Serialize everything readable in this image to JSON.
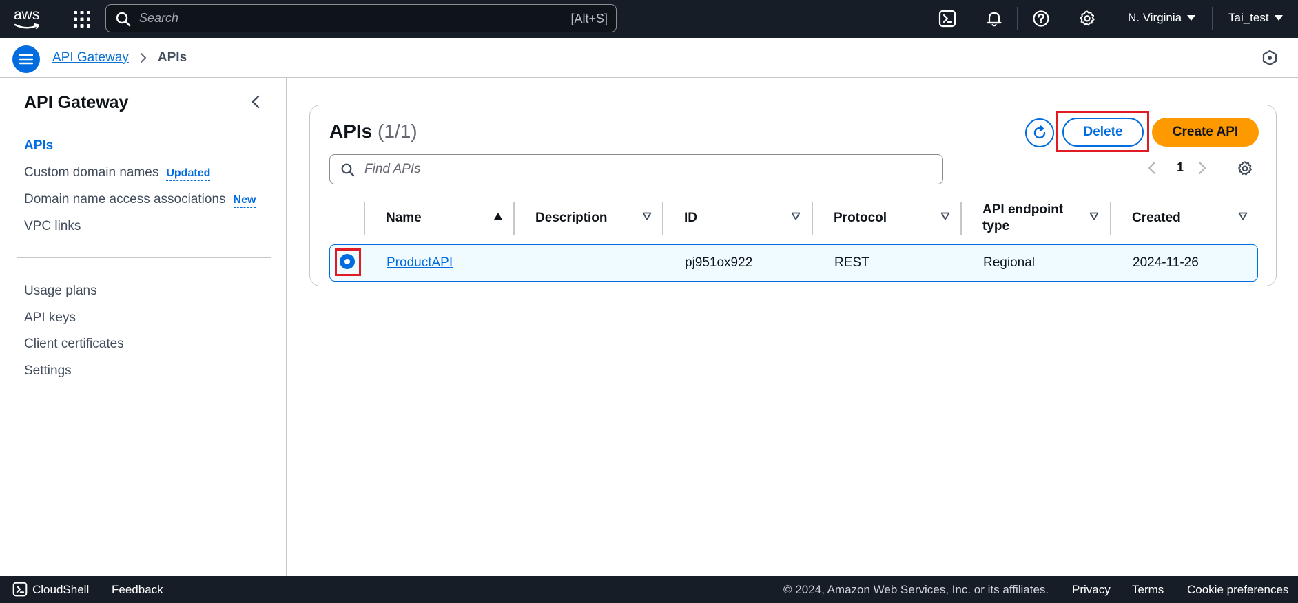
{
  "topnav": {
    "logo_text": "aws",
    "search_placeholder": "Search",
    "search_hint": "[Alt+S]",
    "region": "N. Virginia",
    "user": "Tai_test"
  },
  "breadcrumb": {
    "service": "API Gateway",
    "current": "APIs"
  },
  "sidebar": {
    "title": "API Gateway",
    "items": [
      {
        "label": "APIs",
        "active": true
      },
      {
        "label": "Custom domain names",
        "badge": "Updated"
      },
      {
        "label": "Domain name access associations",
        "badge": "New"
      },
      {
        "label": "VPC links"
      }
    ],
    "items2": [
      {
        "label": "Usage plans"
      },
      {
        "label": "API keys"
      },
      {
        "label": "Client certificates"
      },
      {
        "label": "Settings"
      }
    ]
  },
  "main": {
    "title": "APIs",
    "count": "(1/1)",
    "delete_label": "Delete",
    "create_label": "Create API",
    "find_placeholder": "Find APIs",
    "page_number": "1",
    "columns": [
      "Name",
      "Description",
      "ID",
      "Protocol",
      "API endpoint type",
      "Created"
    ],
    "rows": [
      {
        "name": "ProductAPI",
        "description": "",
        "id": "pj951ox922",
        "protocol": "REST",
        "endpoint_type": "Regional",
        "created": "2024-11-26",
        "selected": true
      }
    ]
  },
  "footer": {
    "cloudshell": "CloudShell",
    "feedback": "Feedback",
    "copyright": "© 2024, Amazon Web Services, Inc. or its affiliates.",
    "privacy": "Privacy",
    "terms": "Terms",
    "cookie": "Cookie preferences"
  },
  "colors": {
    "nav_bg": "#161d26",
    "accent": "#006ce0",
    "primary_button": "#ff9900",
    "annotation_red": "#e01b24"
  }
}
